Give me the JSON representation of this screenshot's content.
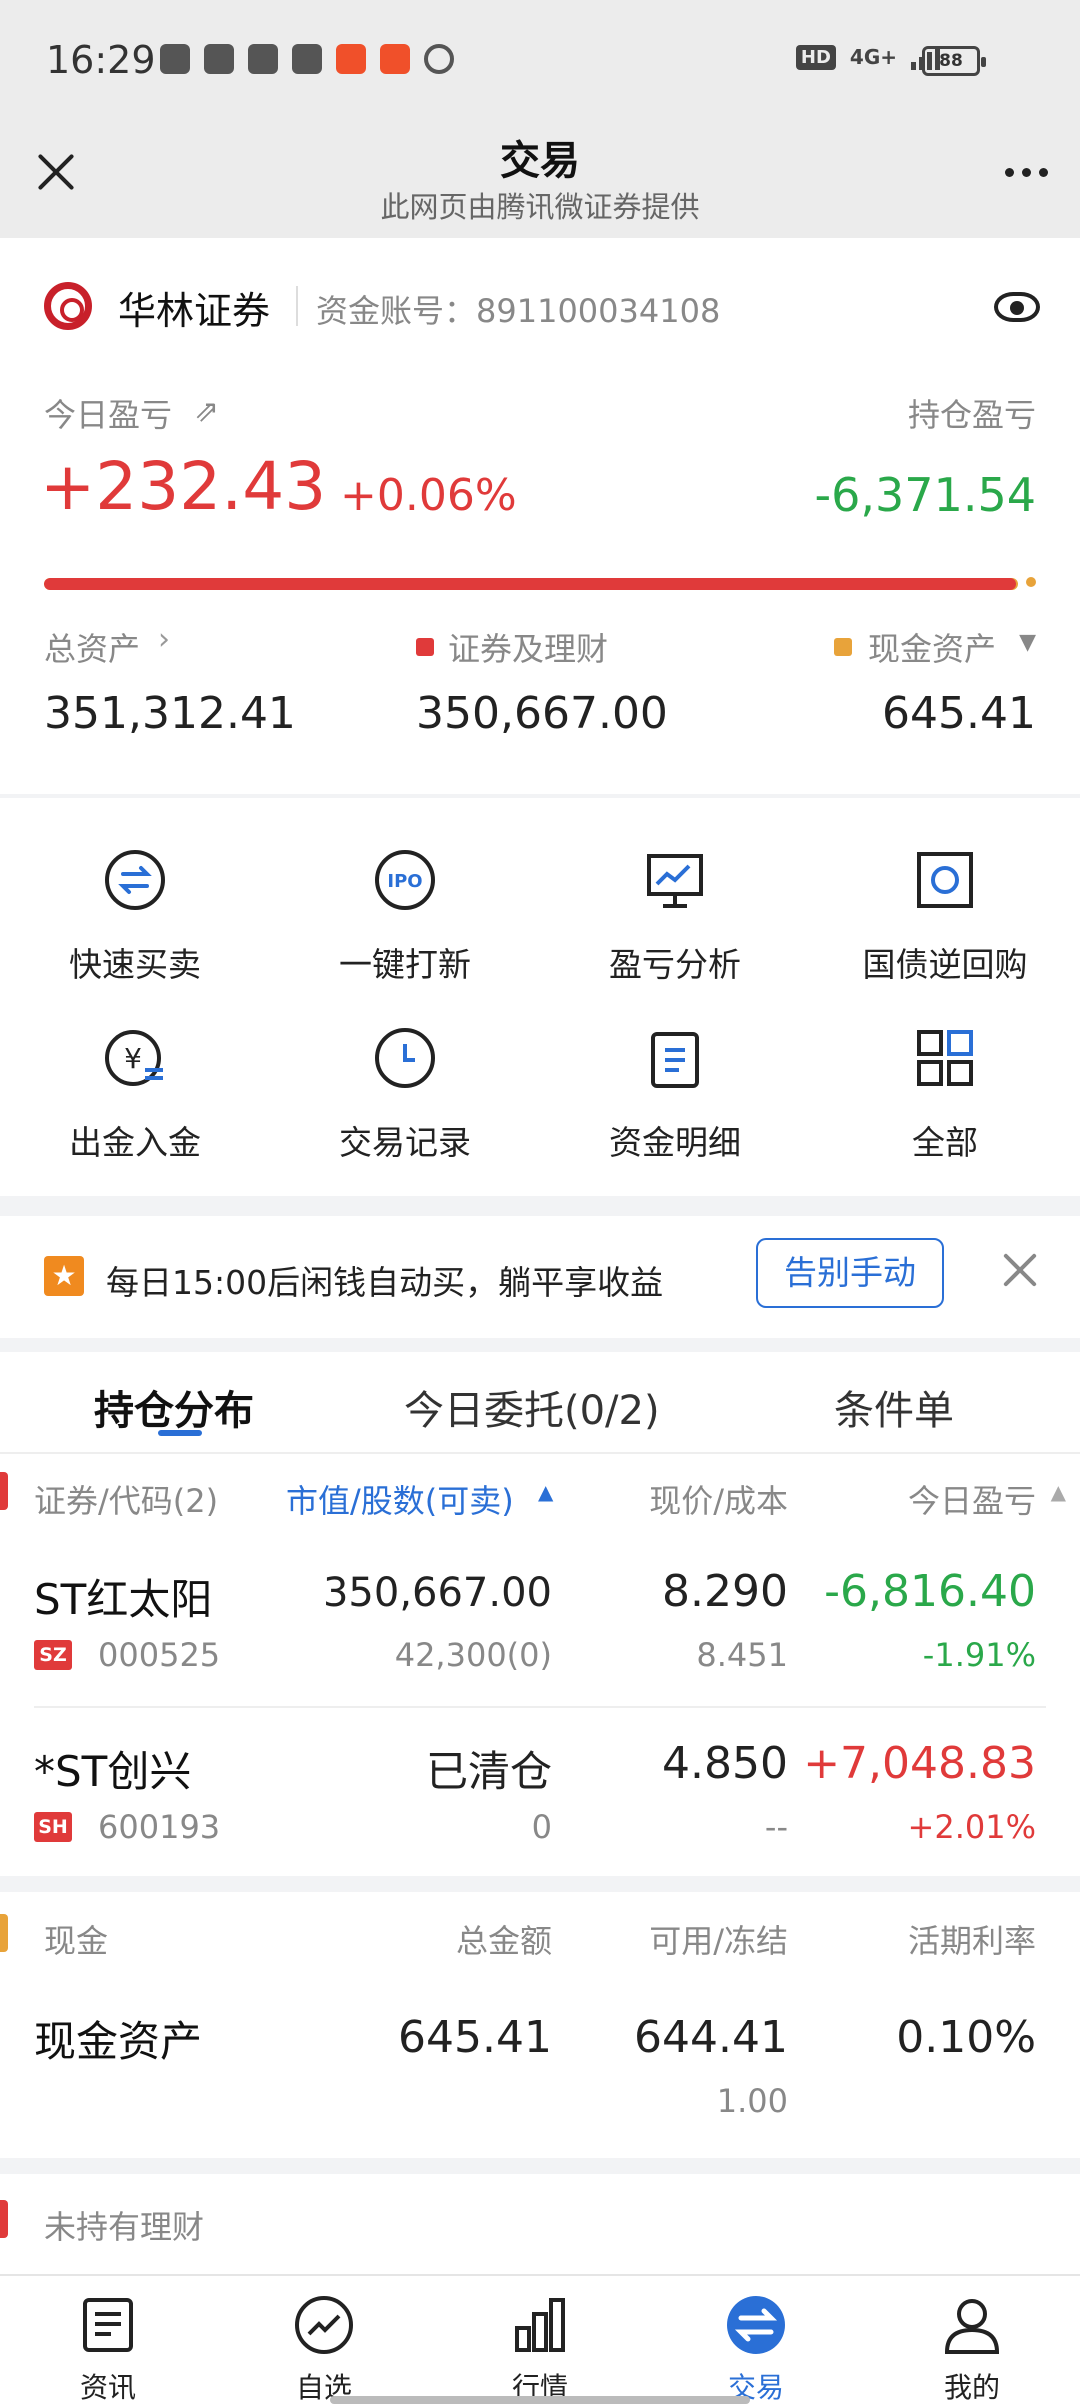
{
  "status_bar": {
    "time": "16:29",
    "network": "4G+",
    "hd": "HD",
    "battery": "88"
  },
  "header": {
    "title": "交易",
    "subtitle": "此网页由腾讯微证券提供"
  },
  "account": {
    "broker": "华林证券",
    "account_label": "资金账号：891100034108",
    "today_pnl_label": "今日盈亏",
    "position_pnl_label": "持仓盈亏",
    "today_pnl": "+232.43",
    "today_pnl_pct": "+0.06%",
    "position_pnl": "-6,371.54",
    "securities_ratio": 0.998,
    "total_assets_label": "总资产",
    "securities_label": "证券及理财",
    "cash_label": "现金资产",
    "total_assets": "351,312.41",
    "securities_value": "350,667.00",
    "cash_value": "645.41"
  },
  "actions": [
    {
      "label": "快速买卖",
      "icon": "quick-trade-icon"
    },
    {
      "label": "一键打新",
      "icon": "ipo-icon"
    },
    {
      "label": "盈亏分析",
      "icon": "pnl-analysis-icon"
    },
    {
      "label": "国债逆回购",
      "icon": "reverse-repo-icon"
    },
    {
      "label": "出金入金",
      "icon": "fund-transfer-icon"
    },
    {
      "label": "交易记录",
      "icon": "trade-history-icon"
    },
    {
      "label": "资金明细",
      "icon": "fund-details-icon"
    },
    {
      "label": "全部",
      "icon": "all-grid-icon"
    }
  ],
  "promo": {
    "text": "每日15:00后闲钱自动买，躺平享收益",
    "button": "告别手动"
  },
  "tabs": [
    {
      "label": "持仓分布",
      "active": true
    },
    {
      "label": "今日委托(0/2)",
      "active": false
    },
    {
      "label": "条件单",
      "active": false
    }
  ],
  "holdings_header": {
    "col1": "证券/代码(2)",
    "col2": "市值/股数(可卖)",
    "col3": "现价/成本",
    "col4": "今日盈亏"
  },
  "holdings": [
    {
      "name": "ST红太阳",
      "market": "SZ",
      "code": "000525",
      "value": "350,667.00",
      "shares": "42,300(0)",
      "price": "8.290",
      "cost": "8.451",
      "pnl": "-6,816.40",
      "pnl_pct": "-1.91%",
      "pnl_color": "#2aa84a"
    },
    {
      "name": "*ST创兴",
      "market": "SH",
      "code": "600193",
      "value": "已清仓",
      "shares": "0",
      "price": "4.850",
      "cost": "--",
      "pnl": "+7,048.83",
      "pnl_pct": "+2.01%",
      "pnl_color": "#e03a3a"
    }
  ],
  "cash_section": {
    "title": "现金",
    "col2": "总金额",
    "col3": "可用/冻结",
    "col4": "活期利率",
    "row_name": "现金资产",
    "total": "645.41",
    "available": "644.41",
    "frozen": "1.00",
    "rate": "0.10%"
  },
  "no_wealth": "未持有理财",
  "bottom_nav": [
    {
      "label": "资讯",
      "icon": "news-icon",
      "active": false
    },
    {
      "label": "自选",
      "icon": "watchlist-icon",
      "active": false
    },
    {
      "label": "行情",
      "icon": "market-icon",
      "active": false
    },
    {
      "label": "交易",
      "icon": "trade-icon",
      "active": true
    },
    {
      "label": "我的",
      "icon": "profile-icon",
      "active": false
    }
  ]
}
